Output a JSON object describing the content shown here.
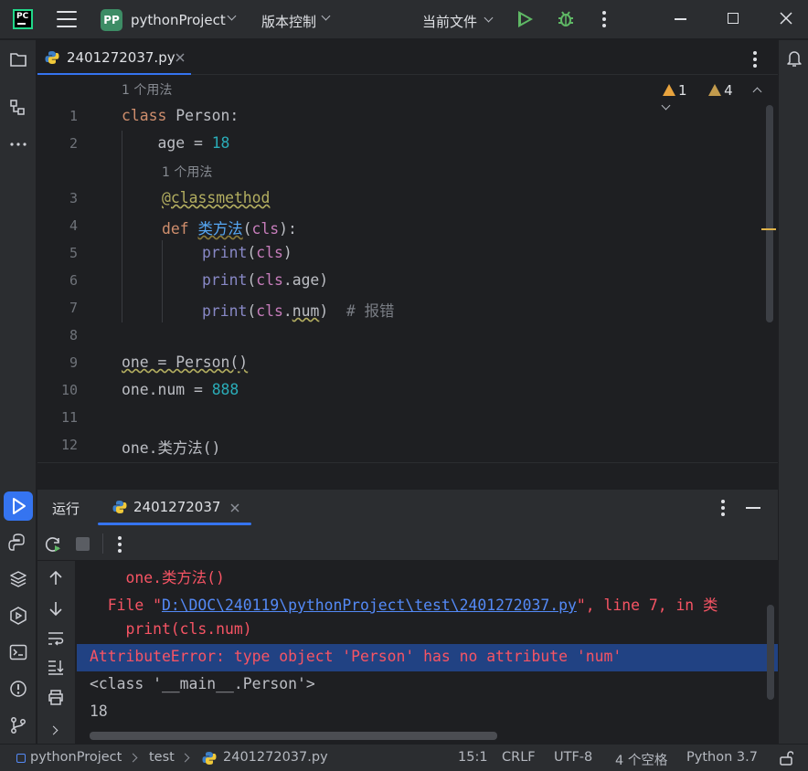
{
  "titlebar": {
    "project_badge": "PP",
    "project_name": "pythonProject",
    "vcs_label": "版本控制",
    "run_config": "当前文件"
  },
  "editor_tab": {
    "label": "2401272037.py"
  },
  "inspections": {
    "errors": "1",
    "warnings": "4"
  },
  "editor": {
    "usage_hint_1": "1 个用法",
    "usage_hint_2": "1 个用法",
    "line_numbers": [
      "1",
      "2",
      "3",
      "4",
      "5",
      "6",
      "7",
      "8",
      "9",
      "10",
      "11",
      "12"
    ],
    "lines": {
      "l1_kw": "class",
      "l1_name": " Person:",
      "l2_name": "    age = ",
      "l2_num": "18",
      "l3_deco": "@classmethod",
      "l4_kw": "def",
      "l4_fn": "类方法",
      "l4_open": "(",
      "l4_param": "cls",
      "l4_close": "):",
      "l5_builtin": "print",
      "l5_open": "(",
      "l5_param": "cls",
      "l5_close": ")",
      "l6_builtin": "print",
      "l6_open": "(",
      "l6_param": "cls",
      "l6_rest": ".age)",
      "l7_builtin": "print",
      "l7_open": "(",
      "l7_param": "cls",
      "l7_dot": ".",
      "l7_attr": "num",
      "l7_close": ")",
      "l7_comment": "  # 报错",
      "l9": "one = Person()",
      "l10_text": "one.num = ",
      "l10_num": "888",
      "l12": "one.类方法()"
    }
  },
  "run_panel": {
    "run_tab_label": "运行",
    "config_tab_label": "2401272037"
  },
  "console": {
    "line1": "    one.类方法()",
    "line2_pre": "  File \"",
    "line2_link": "D:\\DOC\\240119\\pythonProject\\test\\2401272037.py",
    "line2_post": "\", line 7, in 类",
    "line3": "    print(cls.num)",
    "line4": "AttributeError: type object 'Person' has no attribute 'num'",
    "line5": "<class '__main__.Person'>",
    "line6": "18"
  },
  "statusbar": {
    "project": "pythonProject",
    "folder": "test",
    "file": "2401272037.py",
    "position": "15:1",
    "line_ending": "CRLF",
    "encoding": "UTF-8",
    "indent": "4 个空格",
    "interpreter": "Python 3.7"
  }
}
